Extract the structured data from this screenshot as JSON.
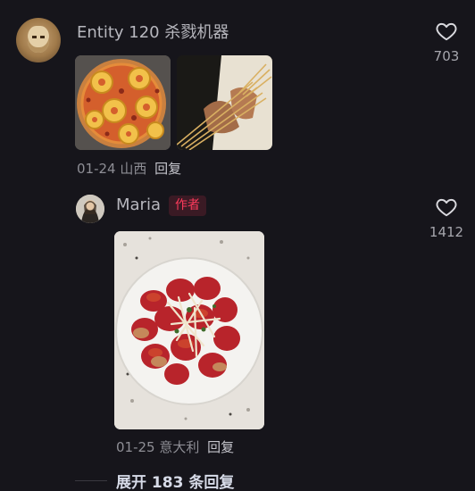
{
  "comment": {
    "username": "Entity 120 杀戮机器",
    "likes": "703",
    "date": "01-24",
    "location": "山西",
    "reply_label": "回复"
  },
  "reply": {
    "username": "Maria",
    "badge": "作者",
    "likes": "1412",
    "date": "01-25",
    "location": "意大利",
    "reply_label": "回复"
  },
  "expand_label": "展开 183 条回复",
  "colors": {
    "background": "#16151b",
    "author_badge": "#ff3b5c",
    "muted_text": "#8e8e95"
  },
  "icons": [
    "heart-icon"
  ]
}
